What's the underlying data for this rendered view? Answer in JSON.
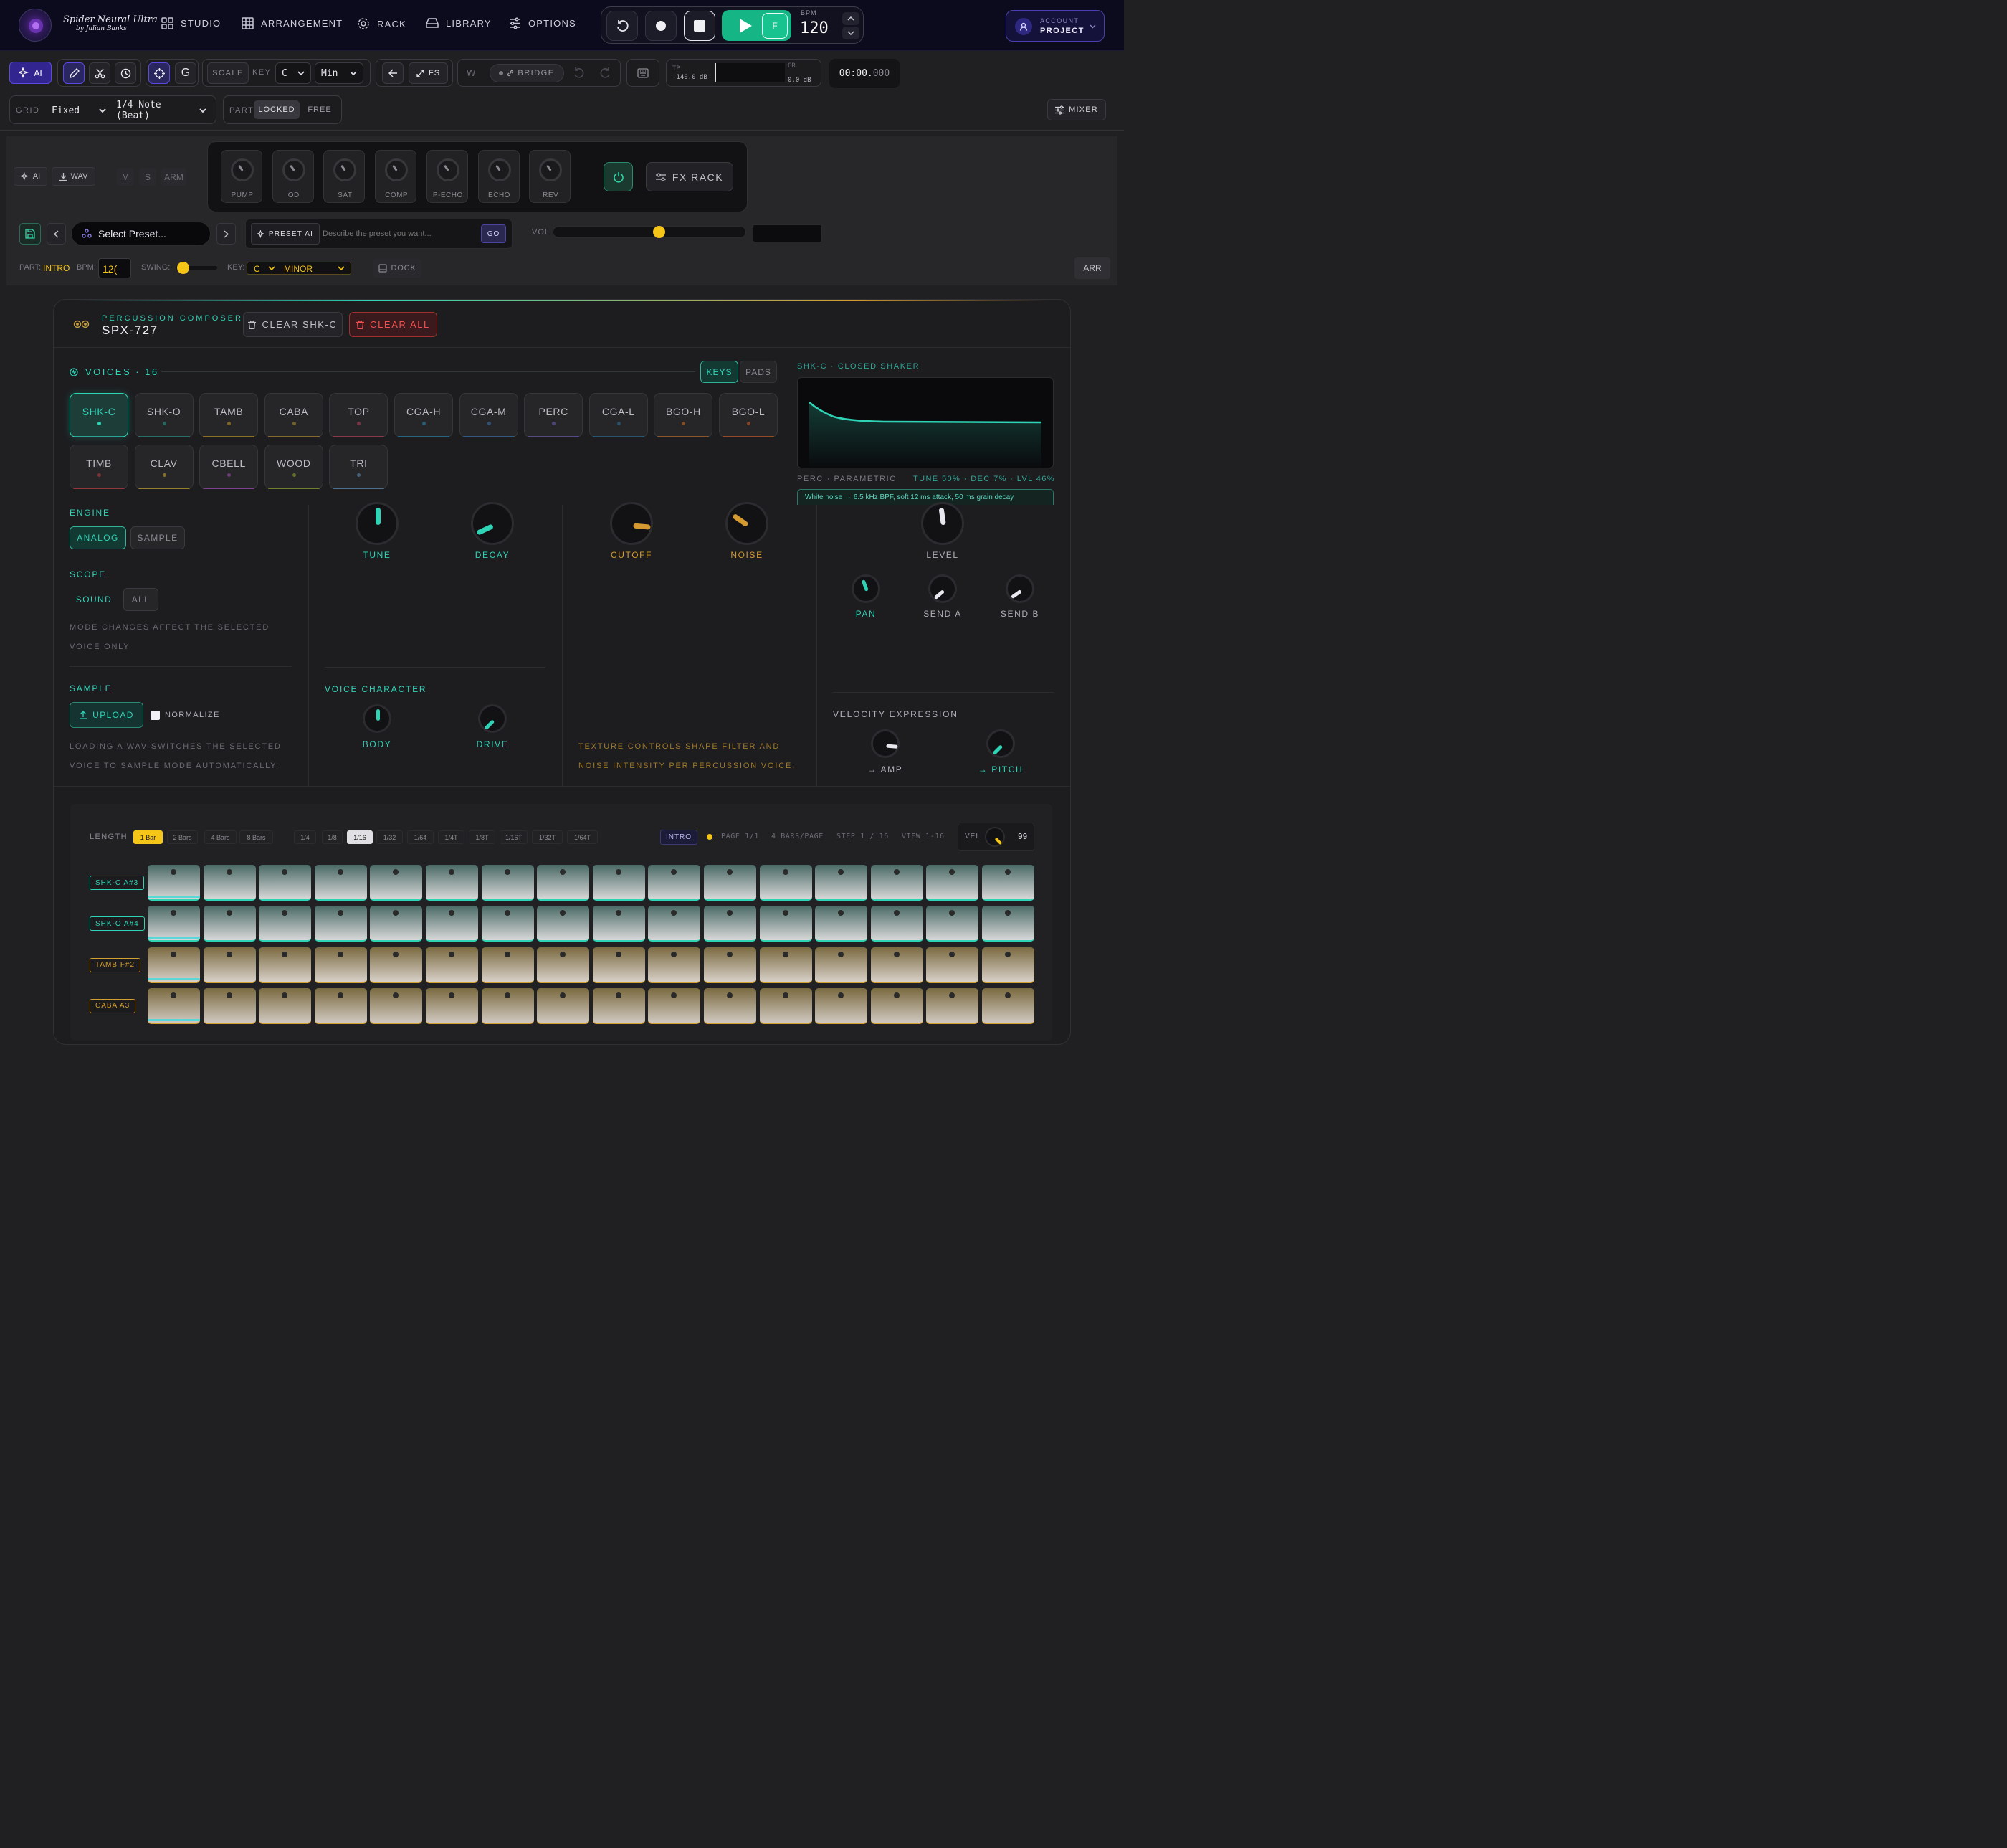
{
  "nav": {
    "studio": "STUDIO",
    "arrangement": "ARRANGEMENT",
    "rack": "RACK",
    "library": "LIBRARY",
    "options": "OPTIONS"
  },
  "transport": {
    "f_label": "F",
    "bpm_label": "BPM",
    "bpm": "120"
  },
  "account": {
    "line1": "ACCOUNT",
    "line2": "PROJECT"
  },
  "toolbar": {
    "ai": "AI",
    "g": "G",
    "scale": "SCALE",
    "key_label": "KEY",
    "key": "C",
    "mode": "Min",
    "fs": "FS",
    "w": "W",
    "bridge": "BRIDGE",
    "tp_label": "TP",
    "tp_value": "-140.0 dB",
    "gr_label": "GR",
    "gr_value": "0.0 dB",
    "time": "00:00.",
    "time_ms": "000"
  },
  "row2": {
    "grid_label": "GRID",
    "grid_mode": "Fixed",
    "grid_value": "1/4 Note (Beat)",
    "part_label": "PART",
    "locked": "LOCKED",
    "free": "FREE",
    "mixer": "MIXER"
  },
  "rack": {
    "ai": "AI",
    "wav": "WAV",
    "m": "M",
    "s": "S",
    "arm": "ARM",
    "fx": [
      "PUMP",
      "OD",
      "SAT",
      "COMP",
      "P-ECHO",
      "ECHO",
      "REV"
    ],
    "fx_rack": "FX RACK",
    "preset_select": "Select Preset...",
    "preset_ai": "PRESET AI",
    "preset_placeholder": "Describe the preset you want...",
    "go": "GO",
    "vol": "VOL",
    "vol_level": 0.55,
    "part_label": "PART:",
    "part": "INTRO",
    "bpm_label": "BPM:",
    "bpm": "12(",
    "swing_label": "SWING:",
    "swing_level": 0.15,
    "key_label": "KEY:",
    "key": "C",
    "mode": "MINOR",
    "dock": "DOCK",
    "arr": "ARR"
  },
  "composer": {
    "subtitle": "PERCUSSION COMPOSER",
    "title": "SPX-727",
    "clear_one": "CLEAR SHK-C",
    "clear_all": "CLEAR ALL",
    "voices_label": "VOICES · 16",
    "keys": "KEYS",
    "pads": "PADS",
    "voices": [
      {
        "name": "SHK-C",
        "color": "#2fd3b5"
      },
      {
        "name": "SHK-O",
        "color": "#2a8f80"
      },
      {
        "name": "TAMB",
        "color": "#b8902a"
      },
      {
        "name": "CABA",
        "color": "#a88a30"
      },
      {
        "name": "TOP",
        "color": "#b0405a"
      },
      {
        "name": "CGA-H",
        "color": "#2a7ea8"
      },
      {
        "name": "CGA-M",
        "color": "#3a6ea8"
      },
      {
        "name": "PERC",
        "color": "#6a5aa8"
      },
      {
        "name": "CGA-L",
        "color": "#2a6a90"
      },
      {
        "name": "BGO-H",
        "color": "#b86a2a"
      },
      {
        "name": "BGO-L",
        "color": "#c05a2a"
      },
      {
        "name": "TIMB",
        "color": "#b83a3a"
      },
      {
        "name": "CLAV",
        "color": "#c0a02a"
      },
      {
        "name": "CBELL",
        "color": "#9a4ab0"
      },
      {
        "name": "WOOD",
        "color": "#8aa02a"
      },
      {
        "name": "TRI",
        "color": "#5a8ab0"
      }
    ],
    "preview_title": "SHK-C · CLOSED SHAKER",
    "preview_left": "PERC · PARAMETRIC",
    "preview_right": "TUNE 50% · DEC 7% · LVL 46%",
    "preview_desc": "White noise → 6.5 kHz BPF, soft 12 ms attack, 50 ms grain decay",
    "engine_label": "ENGINE",
    "analog": "ANALOG",
    "sample_btn": "SAMPLE",
    "scope_label": "SCOPE",
    "sound": "SOUND",
    "all": "ALL",
    "scope_note": "MODE CHANGES AFFECT THE SELECTED VOICE ONLY",
    "sample_label": "SAMPLE",
    "upload": "UPLOAD",
    "normalize": "NORMALIZE",
    "sample_note": "LOADING A WAV SWITCHES THE SELECTED VOICE TO SAMPLE MODE AUTOMATICALLY.",
    "knobs": {
      "tune": "TUNE",
      "decay": "DECAY",
      "cutoff": "CUTOFF",
      "noise": "NOISE",
      "level": "LEVEL",
      "pan": "PAN",
      "send_a": "SEND A",
      "send_b": "SEND B",
      "body": "BODY",
      "drive": "DRIVE",
      "amp": "→ AMP",
      "pitch": "→ PITCH"
    },
    "voice_char": "VOICE CHARACTER",
    "texture_note": "TEXTURE CONTROLS SHAPE FILTER AND NOISE INTENSITY PER PERCUSSION VOICE.",
    "vel_expr": "VELOCITY EXPRESSION"
  },
  "seq": {
    "length_label": "LENGTH",
    "lengths": [
      "1 Bar",
      "2 Bars",
      "4 Bars",
      "8 Bars"
    ],
    "divs": [
      "1/4",
      "1/8",
      "1/16",
      "1/32",
      "1/64",
      "1/4T",
      "1/8T",
      "1/16T",
      "1/32T",
      "1/64T"
    ],
    "part": "INTRO",
    "page": "PAGE 1/1",
    "bars_page": "4 BARS/PAGE",
    "step": "STEP 1 / 16",
    "view": "VIEW 1-16",
    "vel_label": "VEL",
    "vel": "99",
    "rows": [
      {
        "label": "SHK-C A#3",
        "color": "#2fd3b5"
      },
      {
        "label": "SHK-O A#4",
        "color": "#2fd3b5"
      },
      {
        "label": "TAMB F#2",
        "color": "#d4a030"
      },
      {
        "label": "CABA A3",
        "color": "#d4a030"
      }
    ]
  }
}
